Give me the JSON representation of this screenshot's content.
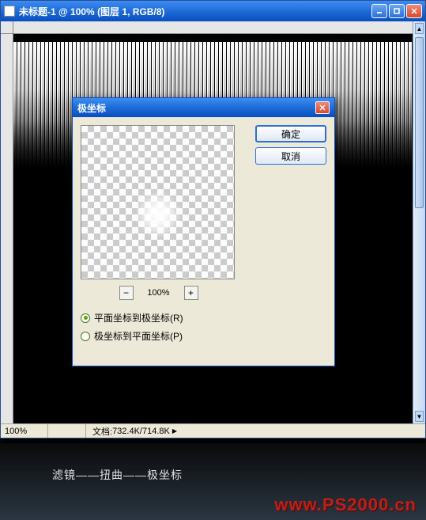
{
  "window": {
    "title": "未标题-1 @ 100% (图层 1, RGB/8)"
  },
  "statusbar": {
    "zoom": "100%",
    "doc_label": "文档:",
    "doc_size": "732.4K/714.8K"
  },
  "dialog": {
    "title": "极坐标",
    "ok_label": "确定",
    "cancel_label": "取消",
    "zoom_value": "100%",
    "minus": "−",
    "plus": "+",
    "radios": {
      "rect_to_polar": "平面坐标到极坐标(R)",
      "polar_to_rect": "极坐标到平面坐标(P)",
      "selected": "rect_to_polar"
    }
  },
  "caption": {
    "text": "滤镜——扭曲——极坐标",
    "watermark": "www.PS2000.cn"
  }
}
